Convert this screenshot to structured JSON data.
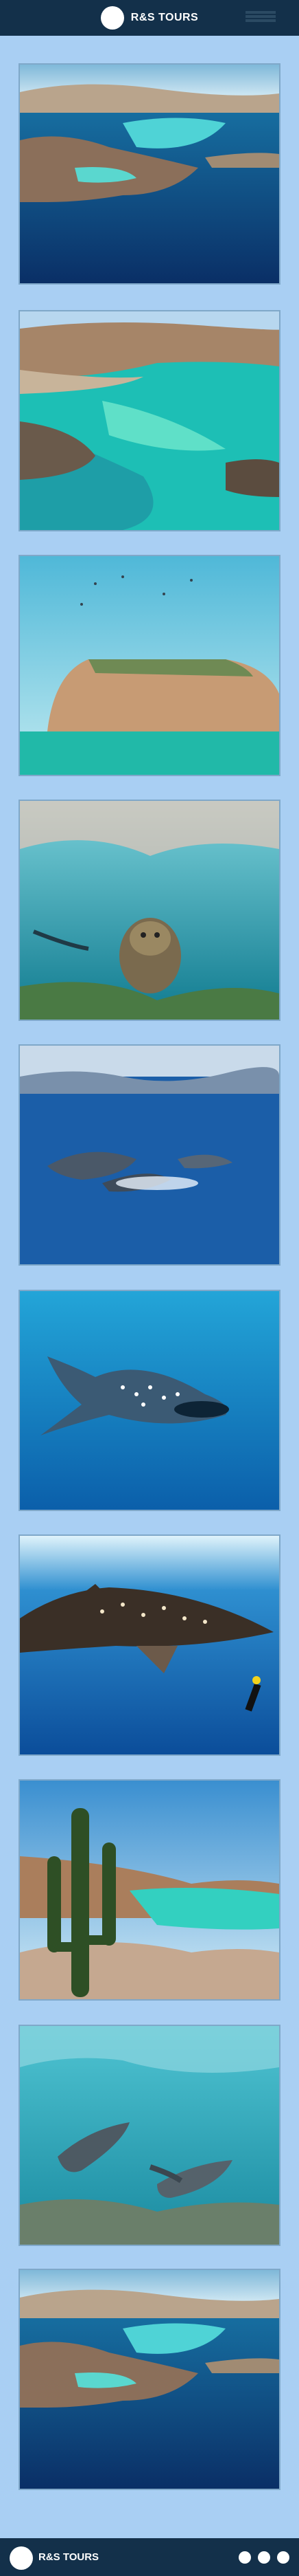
{
  "header": {
    "brand": "R&S TOURS"
  },
  "footer": {
    "brand": "R&S TOURS"
  },
  "gallery": {
    "photos": [
      "aerial-bay-island",
      "turquoise-lagoon-cliffs",
      "rock-island-birds",
      "sea-lion-underwater",
      "dolphins-jumping",
      "whale-shark-blue-water",
      "whale-shark-with-diver",
      "cactus-over-beach",
      "two-sea-lions-underwater",
      "aerial-bay-island-repeat"
    ]
  },
  "colors": {
    "bar": "#13304a",
    "background": "#a9cff3",
    "accent": "#ffffff"
  }
}
